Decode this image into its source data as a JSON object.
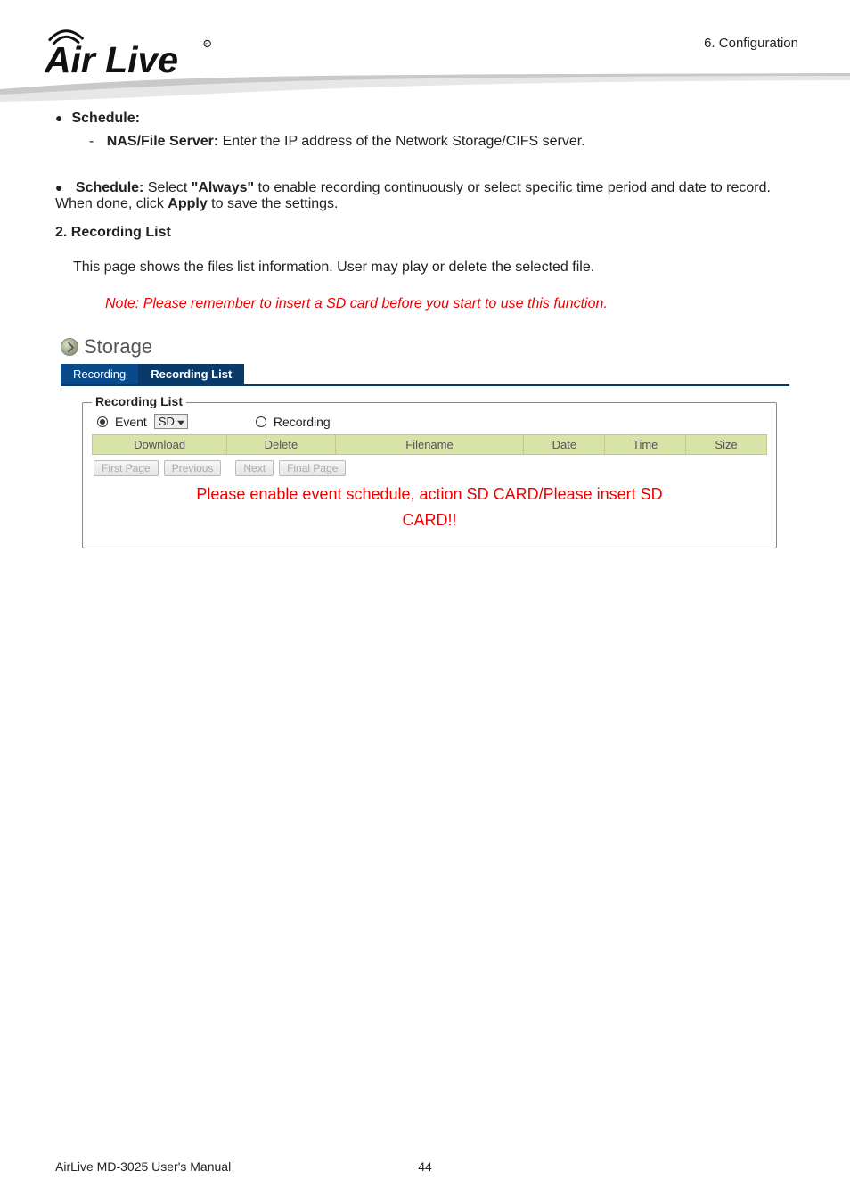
{
  "header": {
    "config": "6. Configuration"
  },
  "content": {
    "schedule_label": "Schedule:",
    "nas_label": "NAS/File Server:",
    "nas_desc": " Enter the IP address of the Network Storage/CIFS server.",
    "schedule2_label": "Schedule:",
    "schedule2_a": "Select ",
    "schedule2_always": "\"Always\"",
    "schedule2_b": " to enable recording continuously or select specific time period and date to record. When done, click ",
    "schedule2_apply": "Apply",
    "schedule2_c": " to save the settings.",
    "num_title": "2.  Recording List",
    "body1": "This page shows the files list information. User may play or delete the selected file.",
    "note": "Note: Please remember to insert a SD card before you start to use this function."
  },
  "panel": {
    "title": "Storage",
    "tabs": {
      "recording": "Recording",
      "list": "Recording List"
    },
    "legend": "Recording List",
    "radio": {
      "event": "Event",
      "select_val": "SD",
      "recording": "Recording"
    },
    "cols": {
      "download": "Download",
      "delete": "Delete",
      "filename": "Filename",
      "date": "Date",
      "time": "Time",
      "size": "Size"
    },
    "pager": {
      "first": "First Page",
      "prev": "Previous",
      "next": "Next",
      "final": "Final Page"
    },
    "warn1": "Please enable event schedule, action SD CARD/Please insert SD",
    "warn2": "CARD!!"
  },
  "footer": {
    "manual": "AirLive MD-3025 User's Manual",
    "page": "44"
  }
}
